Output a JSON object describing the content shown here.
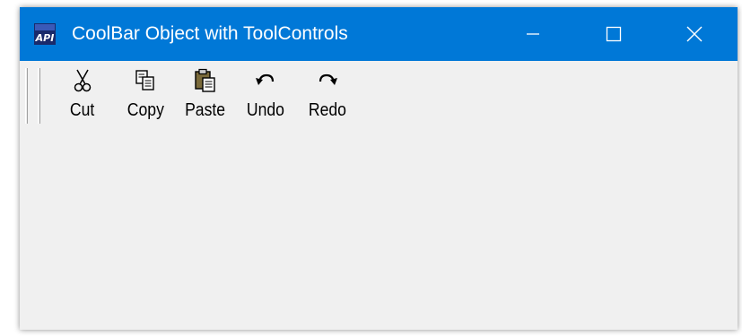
{
  "window": {
    "title": "CoolBar Object with ToolControls",
    "app_icon_text": "API",
    "controls": [
      "minimize",
      "maximize",
      "close"
    ]
  },
  "toolbar": {
    "buttons": [
      {
        "label": "Cut",
        "icon": "scissors-icon"
      },
      {
        "label": "Copy",
        "icon": "copy-icon"
      },
      {
        "label": "Paste",
        "icon": "paste-icon"
      },
      {
        "label": "Undo",
        "icon": "undo-icon"
      },
      {
        "label": "Redo",
        "icon": "redo-icon"
      }
    ]
  },
  "colors": {
    "titlebar": "#0078d7",
    "titlebar_text": "#ffffff",
    "window_background": "#f0f0f0"
  }
}
